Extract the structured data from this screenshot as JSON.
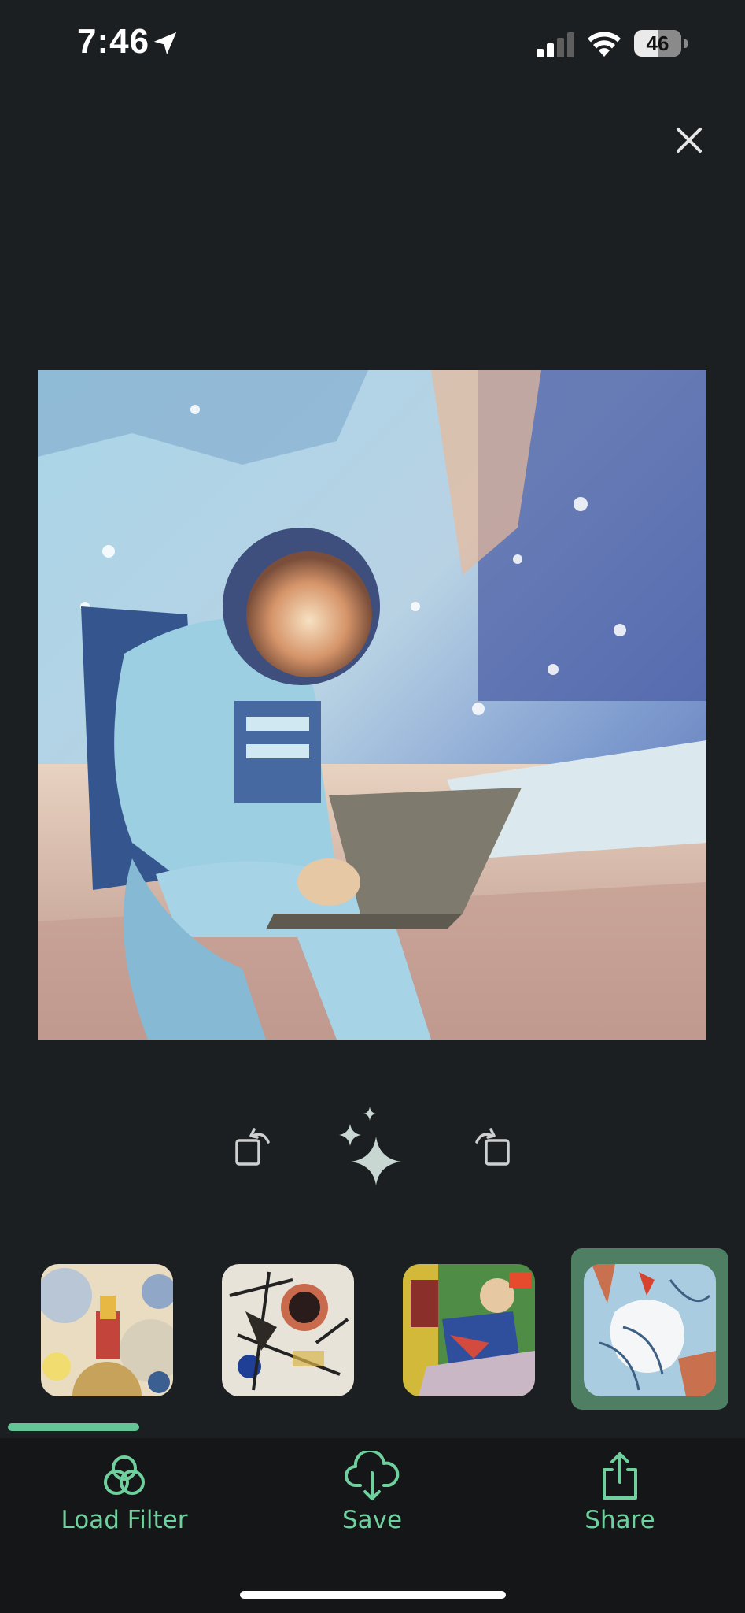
{
  "status_bar": {
    "time": "7:46",
    "battery_level": "46",
    "icons": [
      "location-arrow-icon",
      "cellular-signal-icon",
      "wifi-icon",
      "battery-icon"
    ]
  },
  "header": {
    "close_icon": "close-icon"
  },
  "canvas": {
    "description_icon": "stylized-image",
    "style": "astronaut-with-laptop-filtered"
  },
  "toolbar": {
    "icons": [
      "rotate-left-icon",
      "magic-sparkle-icon",
      "rotate-right-icon"
    ]
  },
  "filters": {
    "items": [
      {
        "icon": "filter-thumbnail-delaunay",
        "selected": false
      },
      {
        "icon": "filter-thumbnail-kandinsky",
        "selected": false
      },
      {
        "icon": "filter-thumbnail-picasso",
        "selected": false
      },
      {
        "icon": "filter-thumbnail-abstract-blue",
        "selected": true
      }
    ],
    "scroll_progress": 0.18
  },
  "actions": {
    "load_filter": {
      "label": "Load Filter",
      "icon": "filter-circles-icon"
    },
    "save": {
      "label": "Save",
      "icon": "cloud-download-icon"
    },
    "share": {
      "label": "Share",
      "icon": "share-icon"
    }
  },
  "colors": {
    "background": "#1c1f21",
    "bottom_bar": "#141617",
    "accent": "#6fcf9d",
    "selected_frame": "#4f7f63"
  }
}
